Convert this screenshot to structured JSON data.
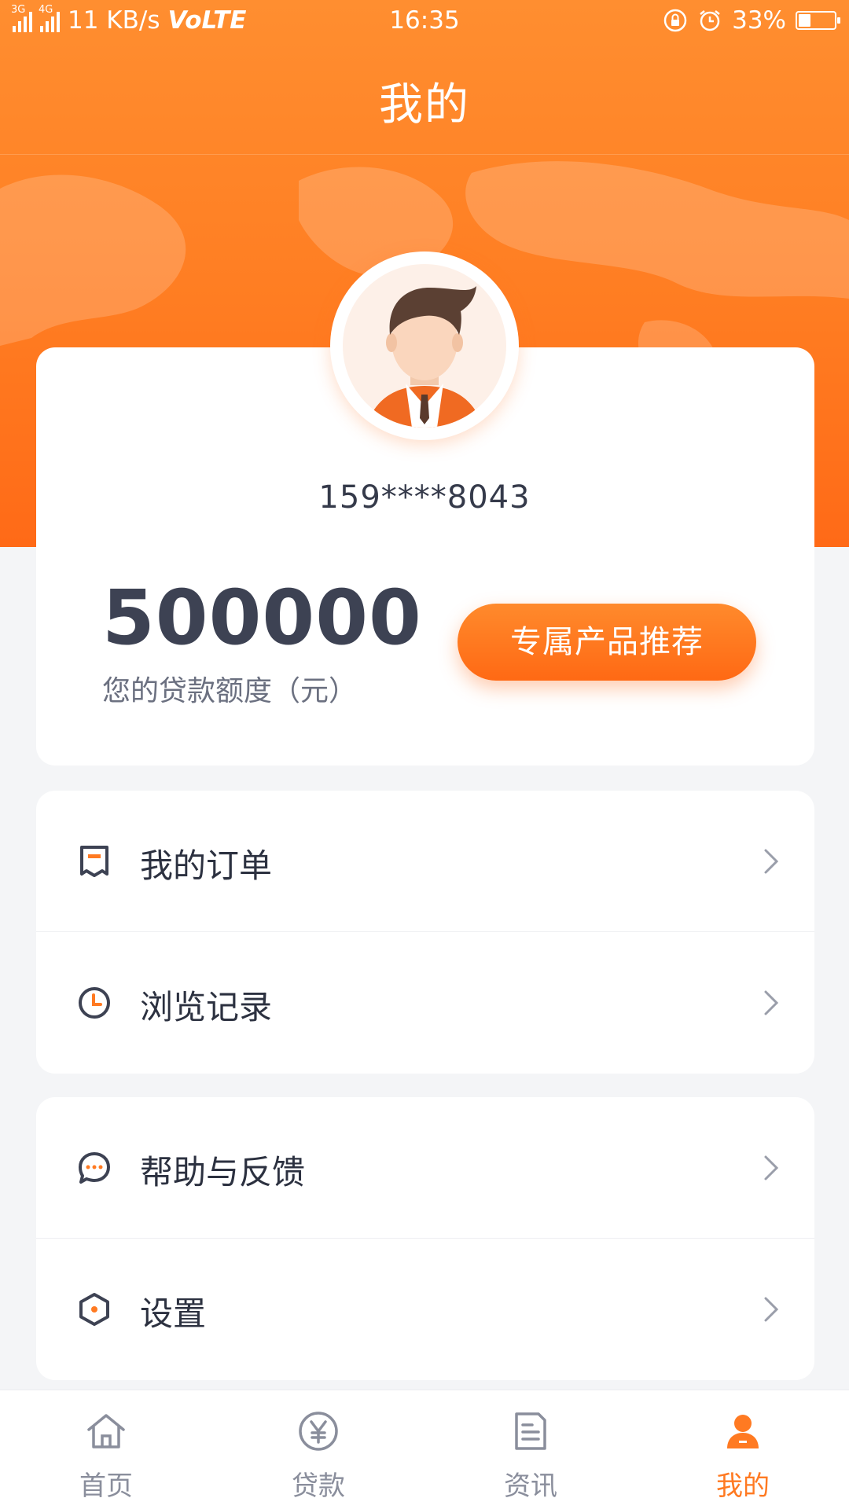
{
  "status_bar": {
    "net1": "3G",
    "net2": "4G",
    "speed": "11 KB/s",
    "volte": "VoLTE",
    "time": "16:35",
    "battery": "33%",
    "battery_level": 0.33
  },
  "header": {
    "title": "我的"
  },
  "profile": {
    "phone": "159****8043",
    "limit_amount": "500000",
    "limit_label": "您的贷款额度（元）",
    "recommend_button": "专属产品推荐"
  },
  "menu": {
    "group1": [
      {
        "label": "我的订单",
        "icon": "order-icon"
      },
      {
        "label": "浏览记录",
        "icon": "clock-icon"
      }
    ],
    "group2": [
      {
        "label": "帮助与反馈",
        "icon": "chat-bubble-icon"
      },
      {
        "label": "设置",
        "icon": "settings-hexagon-icon"
      }
    ]
  },
  "bottom_nav": [
    {
      "label": "首页",
      "icon": "home-icon"
    },
    {
      "label": "贷款",
      "icon": "yuan-icon"
    },
    {
      "label": "资讯",
      "icon": "news-icon"
    },
    {
      "label": "我的",
      "icon": "user-icon",
      "active": true
    }
  ],
  "colors": {
    "accent": "#ff7a22",
    "text_dark": "#2c3140",
    "nav_inactive": "#8a8e9c",
    "background": "#f4f5f7"
  }
}
